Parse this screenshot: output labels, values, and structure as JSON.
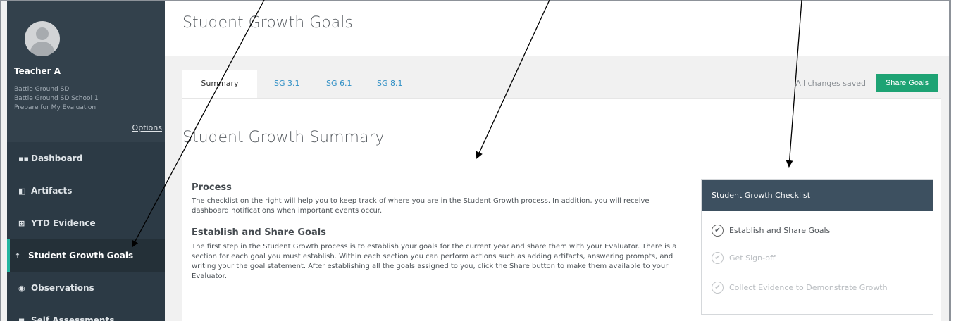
{
  "app": {
    "page_title": "Student Growth Goals"
  },
  "sidebar": {
    "teacher_name": "Teacher A",
    "district": "Battle Ground SD",
    "school": "Battle Ground SD School 1",
    "context": "Prepare for My Evaluation",
    "options_label": "Options",
    "items": [
      {
        "label": "Dashboard",
        "icon": "dashboard-icon",
        "glyph": "▪▪"
      },
      {
        "label": "Artifacts",
        "icon": "artifacts-icon",
        "glyph": "◧"
      },
      {
        "label": "YTD Evidence",
        "icon": "table-icon",
        "glyph": "⊞"
      },
      {
        "label": "Student Growth Goals",
        "icon": "student-growth-icon",
        "glyph": "☨"
      },
      {
        "label": "Observations",
        "icon": "eye-icon",
        "glyph": "◉"
      },
      {
        "label": "Self Assessments",
        "icon": "self-assessment-icon",
        "glyph": "◼"
      }
    ]
  },
  "tabs": [
    {
      "label": "Summary"
    },
    {
      "label": "SG 3.1"
    },
    {
      "label": "SG 6.1"
    },
    {
      "label": "SG 8.1"
    }
  ],
  "status": {
    "saved_text": "All changes saved",
    "share_label": "Share Goals"
  },
  "main": {
    "summary_title": "Student Growth Summary",
    "process_title": "Process",
    "process_text": "The checklist on the right will help you to keep track of where you are in the Student Growth process. In addition, you will receive dashboard notifications when important events occur.",
    "establish_title": "Establish and Share Goals",
    "establish_text": "The first step in the Student Growth process is to establish your goals for the current year and share them with your Evaluator. There is a section for each goal you must establish. Within each section you can perform actions such as adding artifacts, answering prompts, and writing your the goal statement. After establishing all the goals assigned to you, click the Share button to make them available to your Evaluator."
  },
  "checklist": {
    "title": "Student Growth Checklist",
    "items": [
      {
        "label": "Establish and Share Goals",
        "done": true
      },
      {
        "label": "Get Sign-off",
        "done": false
      },
      {
        "label": "Collect Evidence to Demonstrate Growth",
        "done": false
      }
    ]
  },
  "colors": {
    "sidebar": "#2c3a45",
    "accent": "#22b5a0",
    "share_button": "#1ea374",
    "link": "#2f8fc5",
    "checklist_header": "#3d5060"
  }
}
